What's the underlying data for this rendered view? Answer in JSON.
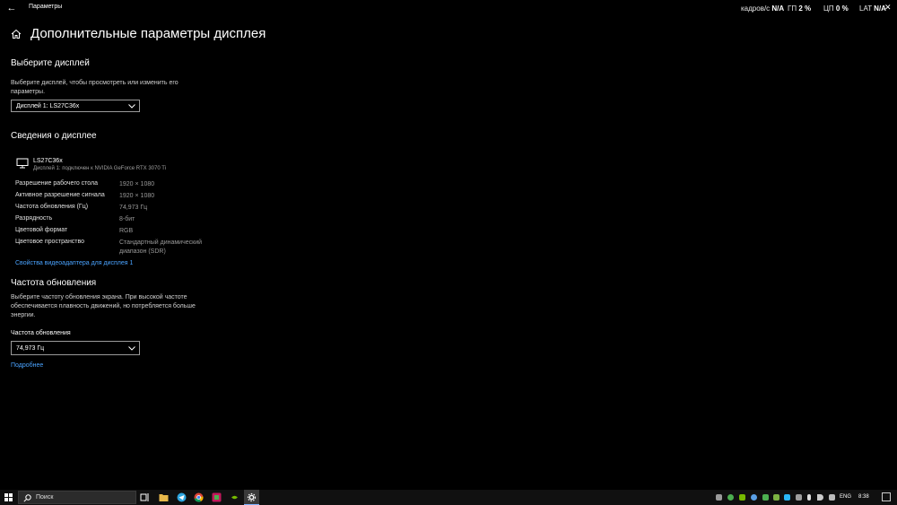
{
  "window": {
    "title": "Параметры"
  },
  "overlay": {
    "fps_label": "кадров/с",
    "fps_value": "N/A",
    "gpu_label": "ГП",
    "gpu_value": "2 %",
    "cpu_label": "ЦП",
    "cpu_value": "0 %",
    "lat_label": "LAT",
    "lat_value": "N/A"
  },
  "page": {
    "title": "Дополнительные параметры дисплея"
  },
  "select_display": {
    "heading": "Выберите дисплей",
    "description": "Выберите дисплей, чтобы просмотреть или изменить его параметры.",
    "dropdown_value": "Дисплей 1: LS27C36x"
  },
  "display_info": {
    "heading": "Сведения о дисплее",
    "monitor_name": "LS27C36x",
    "monitor_sub": "Дисплей 1: подключен к NVIDIA GeForce RTX 3070 Ti",
    "props": [
      {
        "label": "Разрешение рабочего стола",
        "value": "1920 × 1080"
      },
      {
        "label": "Активное разрешение сигнала",
        "value": "1920 × 1080"
      },
      {
        "label": "Частота обновления (Гц)",
        "value": "74,973 Гц"
      },
      {
        "label": "Разрядность",
        "value": "8-бит"
      },
      {
        "label": "Цветовой формат",
        "value": "RGB"
      },
      {
        "label": "Цветовое пространство",
        "value": "Стандартный динамический диапазон (SDR)"
      }
    ],
    "adapter_link": "Свойства видеоадаптера для дисплея 1"
  },
  "refresh": {
    "heading": "Частота обновления",
    "description": "Выберите частоту обновления экрана. При высокой частоте обеспечивается плавность движений, но потребляется больше энергии.",
    "field_label": "Частота обновления",
    "dropdown_value": "74,973 Гц",
    "more_link": "Подробнее"
  },
  "taskbar": {
    "search_placeholder": "Поиск",
    "language": "ENG",
    "time": "8:38"
  },
  "colors": {
    "accent_link": "#4aa3ff",
    "background": "#000000",
    "taskbar": "#101010"
  }
}
